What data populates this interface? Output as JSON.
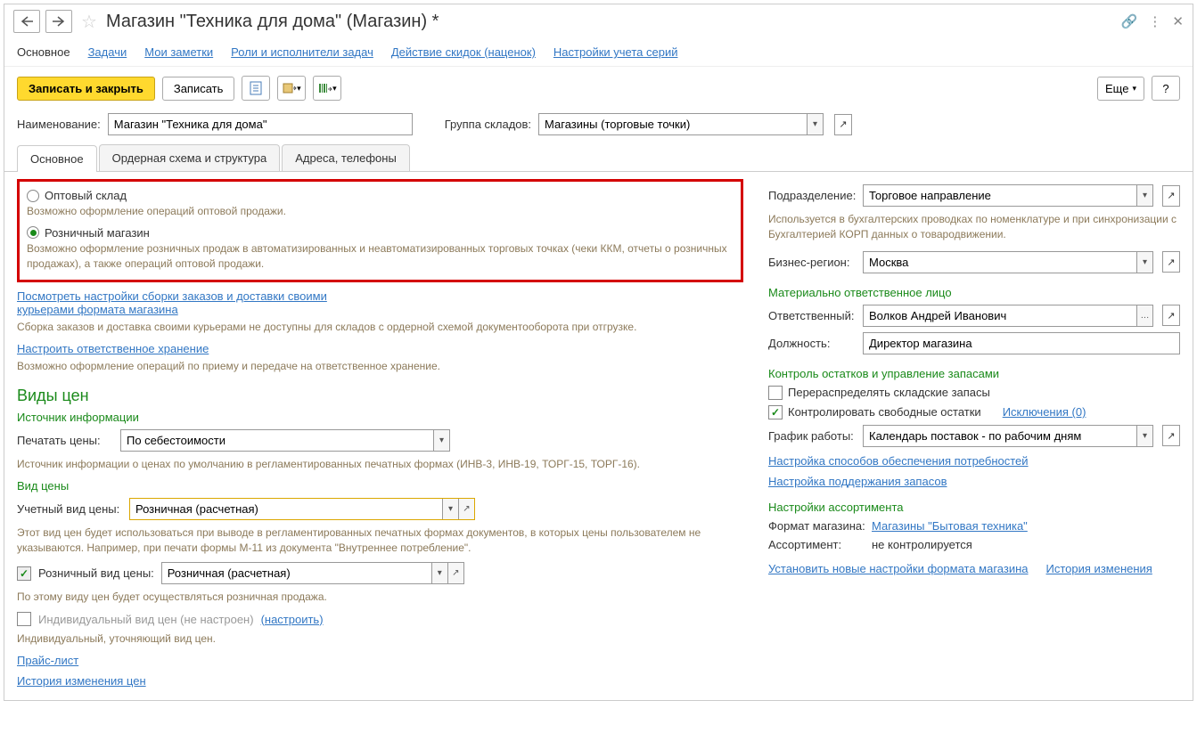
{
  "title": "Магазин \"Техника для дома\" (Магазин) *",
  "menu": {
    "main": "Основное",
    "tasks": "Задачи",
    "notes": "Мои заметки",
    "roles": "Роли и исполнители задач",
    "discounts": "Действие скидок (наценок)",
    "series": "Настройки учета серий"
  },
  "actions": {
    "save_close": "Записать и закрыть",
    "save": "Записать",
    "more": "Еще",
    "help": "?"
  },
  "name_label": "Наименование:",
  "name_value": "Магазин \"Техника для дома\"",
  "group_label": "Группа складов:",
  "group_value": "Магазины (торговые точки)",
  "tabs": {
    "main": "Основное",
    "order": "Ордерная схема и структура",
    "address": "Адреса, телефоны"
  },
  "left": {
    "radio_wholesale": "Оптовый склад",
    "wholesale_hint": "Возможно оформление операций оптовой продажи.",
    "radio_retail": "Розничный магазин",
    "retail_hint": "Возможно оформление розничных продаж в автоматизированных и неавтоматизированных торговых точках (чеки ККМ, отчеты о розничных продажах), а также операций оптовой продажи.",
    "link_delivery1": "Посмотреть настройки сборки заказов и доставки своими",
    "link_delivery2": "курьерами формата магазина",
    "delivery_hint": "Сборка заказов и доставка своими курьерами не доступны для складов с ордерной схемой документооборота при отгрузке.",
    "link_storage": "Настроить ответственное хранение",
    "storage_hint": "Возможно оформление операций по приему и передаче на ответственное хранение.",
    "prices_head": "Виды цен",
    "source_head": "Источник информации",
    "print_label": "Печатать цены:",
    "print_value": "По себестоимости",
    "source_hint": "Источник информации о ценах по умолчанию в регламентированных печатных формах (ИНВ-3, ИНВ-19, ТОРГ-15, ТОРГ-16).",
    "price_type_head": "Вид цены",
    "account_label": "Учетный вид цены:",
    "account_value": "Розничная (расчетная)",
    "account_hint": "Этот вид цен будет использоваться при выводе в регламентированных печатных формах документов, в которых цены пользователем не указываются. Например, при печати формы М-11 из документа \"Внутреннее потребление\".",
    "retail_price_label": "Розничный вид цены:",
    "retail_price_value": "Розничная (расчетная)",
    "retail_price_hint": "По этому виду цен будет осуществляться розничная продажа.",
    "individual_label": "Индивидуальный вид цен (не настроен)",
    "individual_link": "(настроить)",
    "individual_hint": "Индивидуальный, уточняющий вид цен.",
    "link_pricelist": "Прайс-лист",
    "link_history": "История изменения цен"
  },
  "right": {
    "dept_label": "Подразделение:",
    "dept_value": "Торговое направление",
    "dept_hint": "Используется в бухгалтерских проводках по номенклатуре и при синхронизации с Бухгалтерией КОРП данных о товародвижении.",
    "region_label": "Бизнес-регион:",
    "region_value": "Москва",
    "responsible_head": "Материально ответственное лицо",
    "responsible_label": "Ответственный:",
    "responsible_value": "Волков Андрей Иванович",
    "position_label": "Должность:",
    "position_value": "Директор магазина",
    "stock_head": "Контроль остатков и управление запасами",
    "redistribute_label": "Перераспределять складские запасы",
    "control_label": "Контролировать свободные остатки",
    "exceptions_link": "Исключения (0)",
    "schedule_label": "График работы:",
    "schedule_value": "Календарь поставок - по рабочим дням",
    "link_supply": "Настройка способов обеспечения потребностей",
    "link_maintain": "Настройка поддержания запасов",
    "assort_head": "Настройки ассортимента",
    "format_label": "Формат магазина:",
    "format_value": "Магазины \"Бытовая техника\"",
    "assort_label": "Ассортимент:",
    "assort_value": "не контролируется",
    "link_format": "Установить новые настройки формата магазина",
    "link_hist": "История изменения"
  }
}
